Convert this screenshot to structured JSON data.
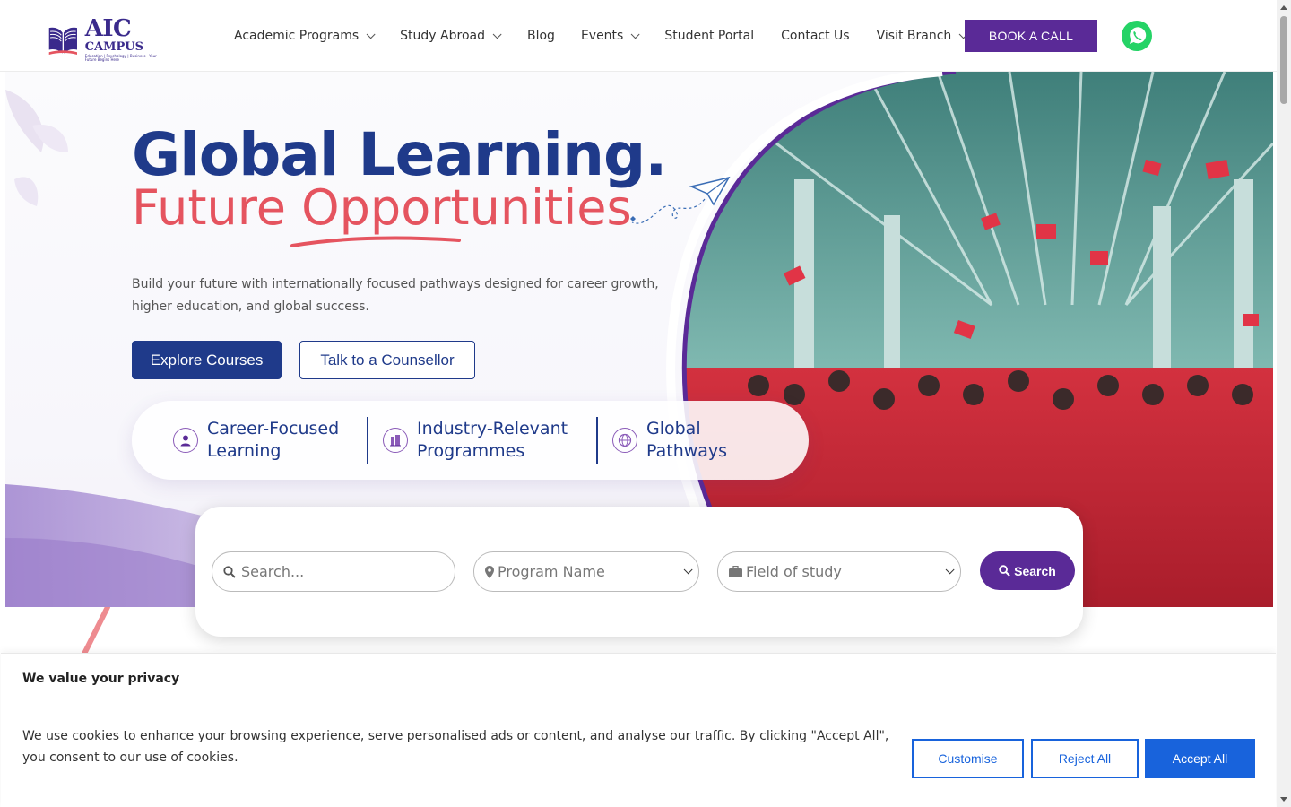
{
  "header": {
    "logo_big": "AIC",
    "logo_mid": "CAMPUS",
    "logo_tagline": "Education | Psychology | Business · Your Future Begins Here",
    "nav": [
      {
        "label": "Academic Programs",
        "dropdown": true
      },
      {
        "label": "Study Abroad",
        "dropdown": true
      },
      {
        "label": "Blog",
        "dropdown": false
      },
      {
        "label": "Events",
        "dropdown": true
      },
      {
        "label": "Student Portal",
        "dropdown": false
      },
      {
        "label": "Contact Us",
        "dropdown": false
      },
      {
        "label": "Visit Branch",
        "dropdown": true
      }
    ],
    "book_call": "BOOK A CALL",
    "whatsapp_icon": "whatsapp-icon"
  },
  "hero": {
    "title_line1": "Global Learning.",
    "title_line2": "Future Opportunities",
    "description": "Build your future with internationally focused pathways designed for career growth, higher education, and global success.",
    "primary_cta": "Explore Courses",
    "secondary_cta": "Talk to a Counsellor",
    "features": [
      {
        "icon": "user-icon",
        "line1": "Career-Focused",
        "line2": "Learning"
      },
      {
        "icon": "building-icon",
        "line1": "Industry-Relevant",
        "line2": "Programmes"
      },
      {
        "icon": "globe-icon",
        "line1": "Global",
        "line2": "Pathways"
      }
    ]
  },
  "search": {
    "placeholder": "Search...",
    "program_select": "Program Name",
    "field_select": "Field of study",
    "button": "Search"
  },
  "cookie": {
    "title": "We value your privacy",
    "text": "We use cookies to enhance your browsing experience, serve personalised ads or content, and analyse our traffic. By clicking \"Accept All\", you consent to our use of cookies.",
    "customise": "Customise",
    "reject": "Reject All",
    "accept": "Accept All"
  },
  "colors": {
    "brand_purple": "#5a2a97",
    "brand_navy": "#1f3a8a",
    "accent_coral": "#e5545f",
    "cookie_blue": "#1863dc"
  }
}
